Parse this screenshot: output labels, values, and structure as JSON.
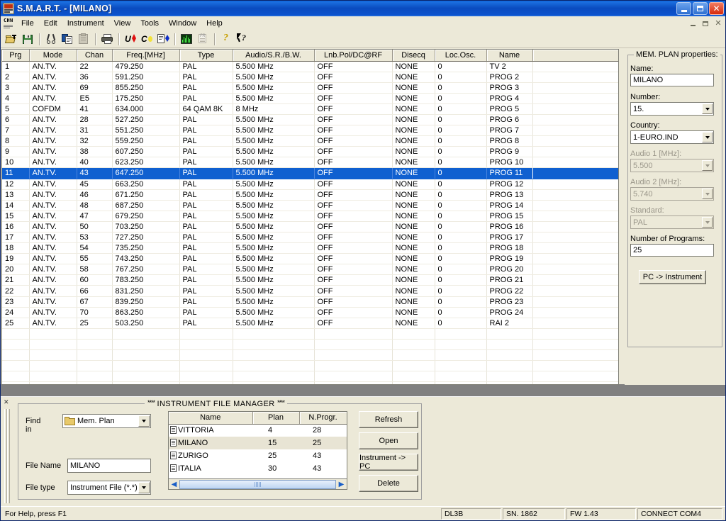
{
  "window": {
    "title": "S.M.A.R.T. - [MILANO]",
    "app_icon": "smart-app-icon",
    "minimize": "minimize-button",
    "maximize": "maximize-button",
    "close": "close-button"
  },
  "menubar": {
    "doc_icon_text": "CHN",
    "items": [
      "File",
      "Edit",
      "Instrument",
      "View",
      "Tools",
      "Window",
      "Help"
    ]
  },
  "toolbar": {
    "buttons": [
      {
        "name": "open-icon",
        "tip": "Open"
      },
      {
        "name": "save-icon",
        "tip": "Save"
      },
      {
        "name": "cut-icon",
        "tip": "Cut"
      },
      {
        "name": "copy-icon",
        "tip": "Copy"
      },
      {
        "name": "paste-icon",
        "tip": "Paste"
      },
      {
        "name": "print-icon",
        "tip": "Print"
      },
      {
        "name": "volt-icon",
        "tip": "V"
      },
      {
        "name": "current-icon",
        "tip": "C"
      },
      {
        "name": "report-icon",
        "tip": "Report"
      },
      {
        "name": "spectrum-icon",
        "tip": "Spectrum"
      },
      {
        "name": "printpreview-icon",
        "tip": "Print Preview"
      },
      {
        "name": "help-icon",
        "tip": "Help"
      },
      {
        "name": "context-help-icon",
        "tip": "Context Help"
      }
    ]
  },
  "mdi_controls": {
    "minimize": "mdi-minimize",
    "restore": "mdi-restore",
    "close": "mdi-close"
  },
  "grid": {
    "columns": [
      "Prg",
      "Mode",
      "Chan",
      "Freq.[MHz]",
      "Type",
      "Audio/S.R./B.W.",
      "Lnb.Pol/DC@RF",
      "Disecq",
      "Loc.Osc.",
      "Name",
      ""
    ],
    "selected_row_index": 10,
    "rows": [
      [
        "1",
        "AN.TV.",
        "22",
        "479.250",
        "PAL",
        "5.500 MHz",
        "OFF",
        "NONE",
        "0",
        "TV  2",
        ""
      ],
      [
        "2",
        "AN.TV.",
        "36",
        "591.250",
        "PAL",
        "5.500 MHz",
        "OFF",
        "NONE",
        "0",
        "PROG 2",
        ""
      ],
      [
        "3",
        "AN.TV.",
        "69",
        "855.250",
        "PAL",
        "5.500 MHz",
        "OFF",
        "NONE",
        "0",
        "PROG 3",
        ""
      ],
      [
        "4",
        "AN.TV.",
        "E5",
        "175.250",
        "PAL",
        "5.500 MHz",
        "OFF",
        "NONE",
        "0",
        "PROG 4",
        ""
      ],
      [
        "5",
        "COFDM",
        "41",
        "634.000",
        "64 QAM 8K",
        "8 MHz",
        "OFF",
        "NONE",
        "0",
        "PROG 5",
        ""
      ],
      [
        "6",
        "AN.TV.",
        "28",
        "527.250",
        "PAL",
        "5.500 MHz",
        "OFF",
        "NONE",
        "0",
        "PROG 6",
        ""
      ],
      [
        "7",
        "AN.TV.",
        "31",
        "551.250",
        "PAL",
        "5.500 MHz",
        "OFF",
        "NONE",
        "0",
        "PROG 7",
        ""
      ],
      [
        "8",
        "AN.TV.",
        "32",
        "559.250",
        "PAL",
        "5.500 MHz",
        "OFF",
        "NONE",
        "0",
        "PROG 8",
        ""
      ],
      [
        "9",
        "AN.TV.",
        "38",
        "607.250",
        "PAL",
        "5.500 MHz",
        "OFF",
        "NONE",
        "0",
        "PROG 9",
        ""
      ],
      [
        "10",
        "AN.TV.",
        "40",
        "623.250",
        "PAL",
        "5.500 MHz",
        "OFF",
        "NONE",
        "0",
        "PROG 10",
        ""
      ],
      [
        "11",
        "AN.TV.",
        "43",
        "647.250",
        "PAL",
        "5.500 MHz",
        "OFF",
        "NONE",
        "0",
        "PROG 11",
        ""
      ],
      [
        "12",
        "AN.TV.",
        "45",
        "663.250",
        "PAL",
        "5.500 MHz",
        "OFF",
        "NONE",
        "0",
        "PROG 12",
        ""
      ],
      [
        "13",
        "AN.TV.",
        "46",
        "671.250",
        "PAL",
        "5.500 MHz",
        "OFF",
        "NONE",
        "0",
        "PROG 13",
        ""
      ],
      [
        "14",
        "AN.TV.",
        "48",
        "687.250",
        "PAL",
        "5.500 MHz",
        "OFF",
        "NONE",
        "0",
        "PROG 14",
        ""
      ],
      [
        "15",
        "AN.TV.",
        "47",
        "679.250",
        "PAL",
        "5.500 MHz",
        "OFF",
        "NONE",
        "0",
        "PROG 15",
        ""
      ],
      [
        "16",
        "AN.TV.",
        "50",
        "703.250",
        "PAL",
        "5.500 MHz",
        "OFF",
        "NONE",
        "0",
        "PROG 16",
        ""
      ],
      [
        "17",
        "AN.TV.",
        "53",
        "727.250",
        "PAL",
        "5.500 MHz",
        "OFF",
        "NONE",
        "0",
        "PROG 17",
        ""
      ],
      [
        "18",
        "AN.TV.",
        "54",
        "735.250",
        "PAL",
        "5.500 MHz",
        "OFF",
        "NONE",
        "0",
        "PROG 18",
        ""
      ],
      [
        "19",
        "AN.TV.",
        "55",
        "743.250",
        "PAL",
        "5.500 MHz",
        "OFF",
        "NONE",
        "0",
        "PROG 19",
        ""
      ],
      [
        "20",
        "AN.TV.",
        "58",
        "767.250",
        "PAL",
        "5.500 MHz",
        "OFF",
        "NONE",
        "0",
        "PROG 20",
        ""
      ],
      [
        "21",
        "AN.TV.",
        "60",
        "783.250",
        "PAL",
        "5.500 MHz",
        "OFF",
        "NONE",
        "0",
        "PROG 21",
        ""
      ],
      [
        "22",
        "AN.TV.",
        "66",
        "831.250",
        "PAL",
        "5.500 MHz",
        "OFF",
        "NONE",
        "0",
        "PROG 22",
        ""
      ],
      [
        "23",
        "AN.TV.",
        "67",
        "839.250",
        "PAL",
        "5.500 MHz",
        "OFF",
        "NONE",
        "0",
        "PROG 23",
        ""
      ],
      [
        "24",
        "AN.TV.",
        "70",
        "863.250",
        "PAL",
        "5.500 MHz",
        "OFF",
        "NONE",
        "0",
        "PROG 24",
        ""
      ],
      [
        "25",
        "AN.TV.",
        "25",
        "503.250",
        "PAL",
        "5.500 MHz",
        "OFF",
        "NONE",
        "0",
        "RAI  2",
        ""
      ]
    ]
  },
  "properties": {
    "legend": "MEM. PLAN properties:",
    "name_label": "Name:",
    "name_value": "MILANO",
    "number_label": "Number:",
    "number_value": "15.",
    "country_label": "Country:",
    "country_value": "1-EURO.IND",
    "audio1_label": "Audio 1 [MHz]:",
    "audio1_value": "5.500",
    "audio2_label": "Audio 2 [MHz]:",
    "audio2_value": "5.740",
    "standard_label": "Standard:",
    "standard_value": "PAL",
    "nprog_label": "Number of Programs:",
    "nprog_value": "25",
    "send_button": "PC -> Instrument"
  },
  "file_manager": {
    "legend_stars_left": "****",
    "legend": "INSTRUMENT FILE MANAGER",
    "legend_stars_right": "****",
    "find_in_label": "Find in",
    "find_in_value": "Mem. Plan",
    "file_name_label": "File Name",
    "file_name_value": "MILANO",
    "file_type_label": "File type",
    "file_type_value": "Instrument File (*.*)",
    "columns": [
      "Name",
      "Plan",
      "N.Progr."
    ],
    "highlighted_row_index": 1,
    "rows": [
      {
        "name": "VITTORIA",
        "plan": "4",
        "nprogr": "28"
      },
      {
        "name": "MILANO",
        "plan": "15",
        "nprogr": "25"
      },
      {
        "name": "ZURIGO",
        "plan": "25",
        "nprogr": "43"
      },
      {
        "name": "ITALIA",
        "plan": "30",
        "nprogr": "43"
      }
    ],
    "scroll_left": "◀",
    "scroll_right": "▶",
    "buttons": [
      "Refresh",
      "Open",
      "Instrument -> PC",
      "Delete"
    ]
  },
  "statusbar": {
    "hint": "For Help, press F1",
    "panes": [
      "DL3B",
      "SN. 1862",
      "FW   1.43",
      "CONNECT COM4"
    ]
  },
  "colors": {
    "titlebar_blue": "#0a4bbf",
    "selection_blue": "#1060d0",
    "face": "#ece9d8",
    "workspace": "#808080"
  }
}
